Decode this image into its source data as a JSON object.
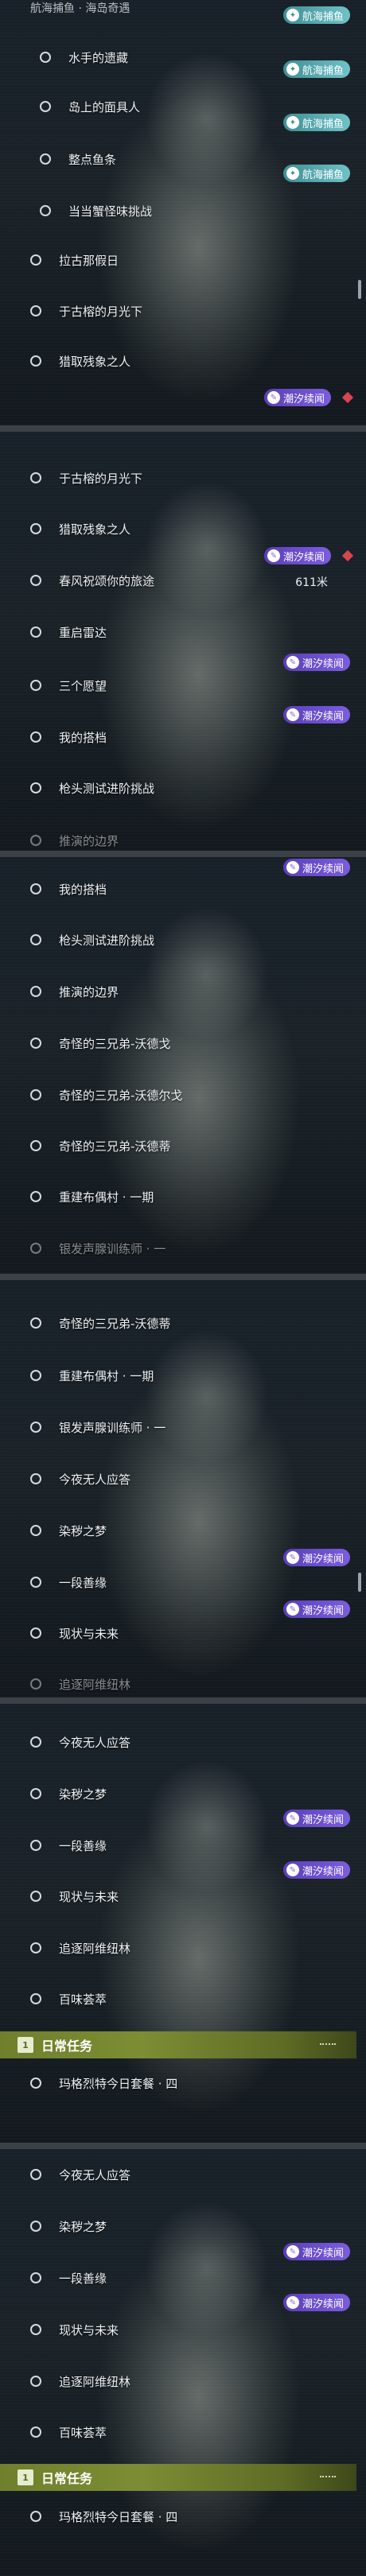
{
  "tags": {
    "hanghai": "航海捕鱼",
    "chaoxi": "潮汐续闻"
  },
  "panel1": {
    "title": "航海捕鱼 · 海岛奇遇",
    "items": [
      "水手的遗藏",
      "岛上的面具人",
      "整点鱼条",
      "当当蟹怪味挑战",
      "拉古那假日",
      "于古榕的月光下",
      "猎取残象之人"
    ]
  },
  "panel2": {
    "items": [
      "于古榕的月光下",
      "猎取残象之人",
      "春风祝颂你的旅途",
      "重启雷达",
      "三个愿望",
      "我的搭档",
      "枪头测试进阶挑战",
      "推演的边界"
    ],
    "distance": "611米"
  },
  "panel3": {
    "items": [
      "我的搭档",
      "枪头测试进阶挑战",
      "推演的边界",
      "奇怪的三兄弟-沃德戈",
      "奇怪的三兄弟-沃德尔戈",
      "奇怪的三兄弟-沃德蒂",
      "重建布偶村 · 一期",
      "银发声腺训练师 · 一"
    ]
  },
  "panel4": {
    "items": [
      "奇怪的三兄弟-沃德蒂",
      "重建布偶村 · 一期",
      "银发声腺训练师 · 一",
      "今夜无人应答",
      "染秽之梦",
      "一段善缘",
      "现状与未来",
      "追逐阿维纽林"
    ]
  },
  "panel5": {
    "items": [
      "今夜无人应答",
      "染秽之梦",
      "一段善缘",
      "现状与未来",
      "追逐阿维纽林",
      "百味荟萃"
    ],
    "header": "日常任务",
    "daily": "玛格烈特今日套餐 · 四"
  },
  "panel6": {
    "items": [
      "今夜无人应答",
      "染秽之梦",
      "一段善缘",
      "现状与未来",
      "追逐阿维纽林",
      "百味荟萃"
    ],
    "header": "日常任务",
    "daily": "玛格烈特今日套餐 · 四"
  }
}
